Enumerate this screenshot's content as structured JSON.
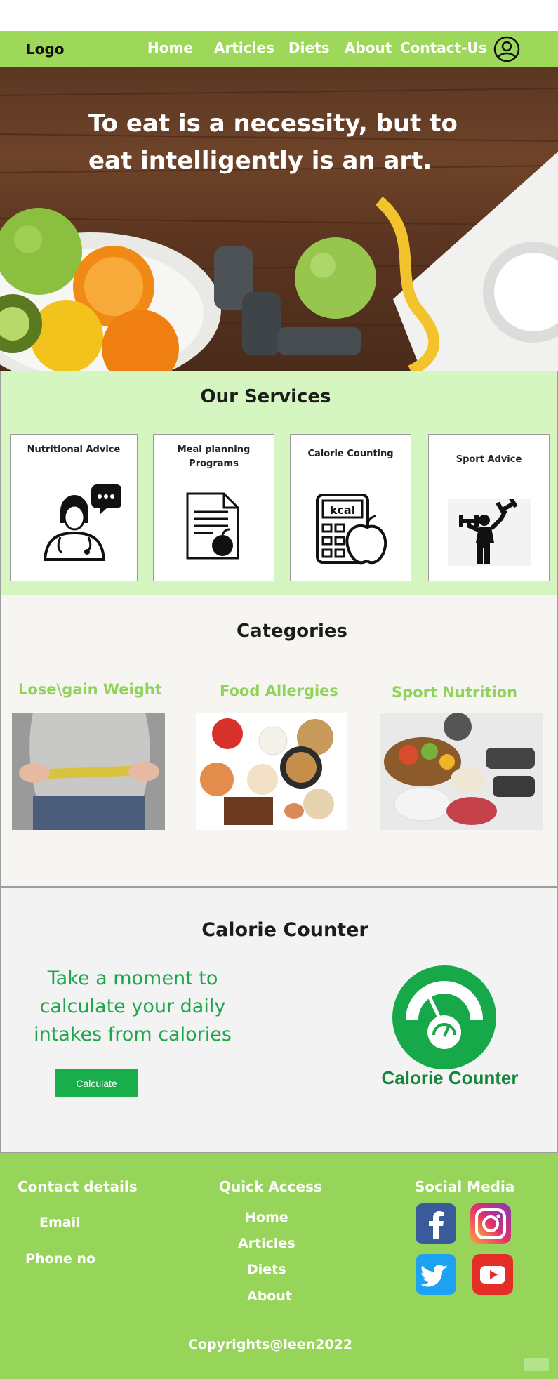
{
  "nav": {
    "logo": "Logo",
    "links": [
      "Home",
      "Articles",
      "Diets",
      "About",
      "Contact-Us"
    ],
    "user_icon": "user-circle-icon"
  },
  "hero": {
    "quote": "To eat is a necessity, but to eat intelligently is an art."
  },
  "services": {
    "title": "Our Services",
    "items": [
      {
        "label": "Nutritional Advice",
        "icon": "doctor-chat-icon"
      },
      {
        "label": "Meal planning Programs",
        "icon": "document-apple-icon"
      },
      {
        "label": "Calorie Counting",
        "icon": "calculator-kcal-icon"
      },
      {
        "label": "Sport Advice",
        "icon": "weightlifter-icon"
      }
    ]
  },
  "categories": {
    "title": "Categories",
    "items": [
      {
        "label": "Lose\\gain Weight",
        "image": "waist-measure-photo"
      },
      {
        "label": "Food Allergies",
        "image": "allergen-foods-photo"
      },
      {
        "label": "Sport Nutrition",
        "image": "food-dumbbells-photo"
      }
    ]
  },
  "calorie_counter": {
    "title": "Calorie Counter",
    "text": "Take a moment to calculate your daily intakes from calories",
    "button_label": "Calculate",
    "logo_label": "Calorie Counter"
  },
  "footer": {
    "contact": {
      "title": "Contact details",
      "email": "Email",
      "phone": "Phone no"
    },
    "quick_access": {
      "title": "Quick Access",
      "links": [
        "Home",
        "Articles",
        "Diets",
        "About"
      ]
    },
    "social": {
      "title": "Social Media",
      "icons": [
        "facebook-icon",
        "instagram-icon",
        "twitter-icon",
        "youtube-icon"
      ]
    },
    "copyright": "Copyrights@leen2022"
  },
  "colors": {
    "nav_green": "#9ed85a",
    "services_bg": "#d6f6c1",
    "category_label": "#8fd35a",
    "calorie_green": "#1aad4b",
    "footer_green": "#97d55a"
  }
}
